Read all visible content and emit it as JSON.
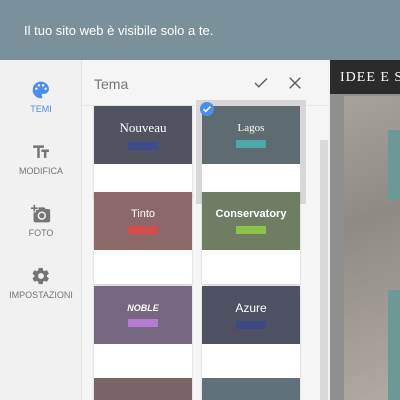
{
  "notice": {
    "text": "Il tuo sito web è visibile solo a te."
  },
  "nav": {
    "items": [
      {
        "label": "TEMI"
      },
      {
        "label": "MODIFICA"
      },
      {
        "label": "FOTO"
      },
      {
        "label": "IMPOSTAZIONI"
      }
    ]
  },
  "panel": {
    "title": "Tema"
  },
  "themes": [
    {
      "name": "Nouveau",
      "bg": "#525360",
      "bar": "#3f4b8a"
    },
    {
      "name": "Lagos",
      "bg": "#5e6b70",
      "bar": "#4ea8a9"
    },
    {
      "name": "Tinto",
      "bg": "#8c6868",
      "bar": "#d64b4b"
    },
    {
      "name": "Conservatory",
      "bg": "#6f7d63",
      "bar": "#8bc34a"
    },
    {
      "name": "NOBLE",
      "bg": "#75677f",
      "bar": "#b57bd4"
    },
    {
      "name": "Azure",
      "bg": "#4d5161",
      "bar": "#3c4a84"
    },
    {
      "name": "",
      "bg": "#7a6569",
      "bar": "#7a6569"
    },
    {
      "name": "",
      "bg": "#60717b",
      "bar": "#60717b"
    }
  ],
  "preview": {
    "title": "IDEE E SO"
  },
  "colors": {
    "accent": "#4a8ef0",
    "topbar": "#7a909b"
  }
}
